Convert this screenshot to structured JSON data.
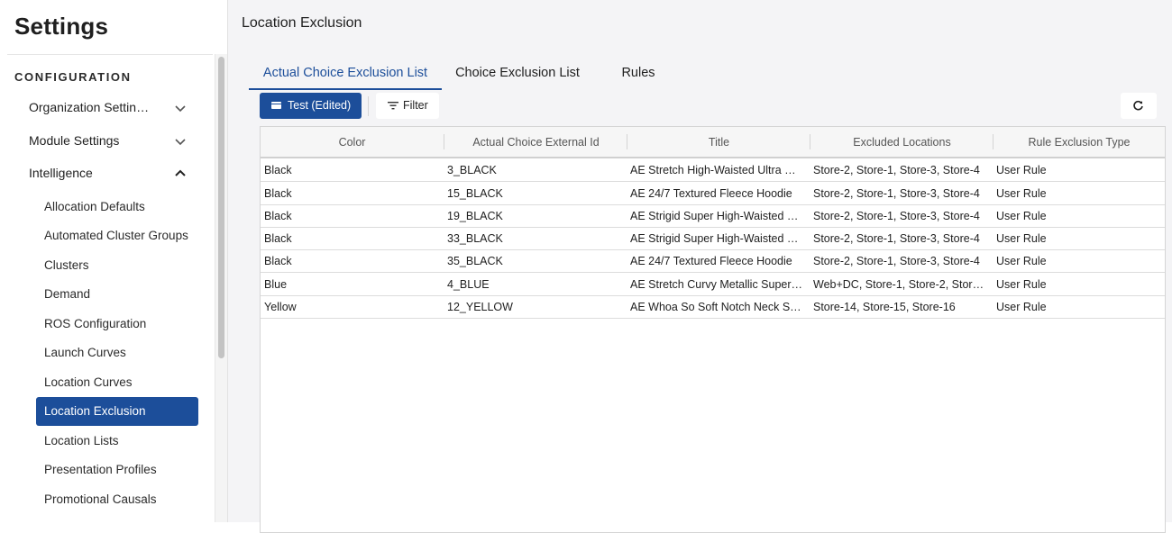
{
  "sidebar": {
    "title": "Settings",
    "section": "CONFIGURATION",
    "groups": [
      {
        "label": "Organization Settin…"
      },
      {
        "label": "Module Settings"
      },
      {
        "label": "Intelligence"
      }
    ],
    "items": [
      {
        "label": "Allocation Defaults"
      },
      {
        "label": "Automated Cluster Groups"
      },
      {
        "label": "Clusters"
      },
      {
        "label": "Demand"
      },
      {
        "label": "ROS Configuration"
      },
      {
        "label": "Launch Curves"
      },
      {
        "label": "Location Curves"
      },
      {
        "label": "Location Exclusion"
      },
      {
        "label": "Location Lists"
      },
      {
        "label": "Presentation Profiles"
      },
      {
        "label": "Promotional Causals"
      }
    ]
  },
  "main": {
    "title": "Location Exclusion",
    "tabs": [
      {
        "label": "Actual Choice Exclusion List"
      },
      {
        "label": "Choice Exclusion List"
      },
      {
        "label": "Rules"
      }
    ],
    "toolbar": {
      "view_label": "Test (Edited)",
      "filter_label": "Filter"
    },
    "table": {
      "columns": [
        "Color",
        "Actual Choice External Id",
        "Title",
        "Excluded Locations",
        "Rule Exclusion Type"
      ],
      "rows": [
        [
          "Black",
          "3_BLACK",
          "AE Stretch High-Waisted Ultra …",
          "Store-2, Store-1, Store-3, Store-4",
          "User Rule"
        ],
        [
          "Black",
          "15_BLACK",
          "AE 24/7 Textured Fleece Hoodie",
          "Store-2, Store-1, Store-3, Store-4",
          "User Rule"
        ],
        [
          "Black",
          "19_BLACK",
          "AE Strigid Super High-Waisted …",
          "Store-2, Store-1, Store-3, Store-4",
          "User Rule"
        ],
        [
          "Black",
          "33_BLACK",
          "AE Strigid Super High-Waisted …",
          "Store-2, Store-1, Store-3, Store-4",
          "User Rule"
        ],
        [
          "Black",
          "35_BLACK",
          "AE 24/7 Textured Fleece Hoodie",
          "Store-2, Store-1, Store-3, Store-4",
          "User Rule"
        ],
        [
          "Blue",
          "4_BLUE",
          "AE Stretch Curvy Metallic Super…",
          "Web+DC, Store-1, Store-2, Stor…",
          "User Rule"
        ],
        [
          "Yellow",
          "12_YELLOW",
          "AE Whoa So Soft Notch Neck S…",
          "Store-14, Store-15, Store-16",
          "User Rule"
        ]
      ]
    }
  },
  "colors": {
    "accent": "#1c4e9a",
    "main_background": "#f4f4f6"
  },
  "icons": [
    "chevron-down-icon",
    "chevron-up-icon",
    "view-icon",
    "filter-icon",
    "refresh-icon"
  ]
}
